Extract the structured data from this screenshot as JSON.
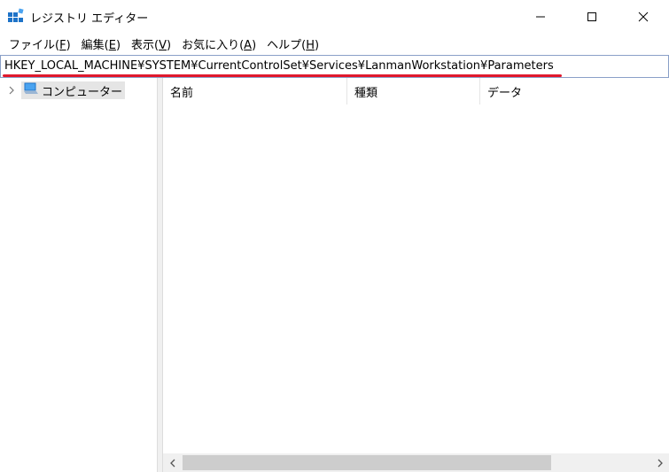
{
  "window": {
    "title": "レジストリ エディター",
    "icon": "registry-editor-icon"
  },
  "menu": [
    {
      "label": "ファイル(",
      "key": "F",
      "end": ")"
    },
    {
      "label": "編集(",
      "key": "E",
      "end": ")"
    },
    {
      "label": "表示(",
      "key": "V",
      "end": ")"
    },
    {
      "label": "お気に入り(",
      "key": "A",
      "end": ")"
    },
    {
      "label": "ヘルプ(",
      "key": "H",
      "end": ")"
    }
  ],
  "address": {
    "path": "HKEY_LOCAL_MACHINE¥SYSTEM¥CurrentControlSet¥Services¥LanmanWorkstation¥Parameters",
    "highlight_color": "#e0182c"
  },
  "tree": {
    "root_label": "コンピューター",
    "root_icon": "computer-icon"
  },
  "list": {
    "columns": {
      "name": "名前",
      "type": "種類",
      "data": "データ"
    }
  }
}
